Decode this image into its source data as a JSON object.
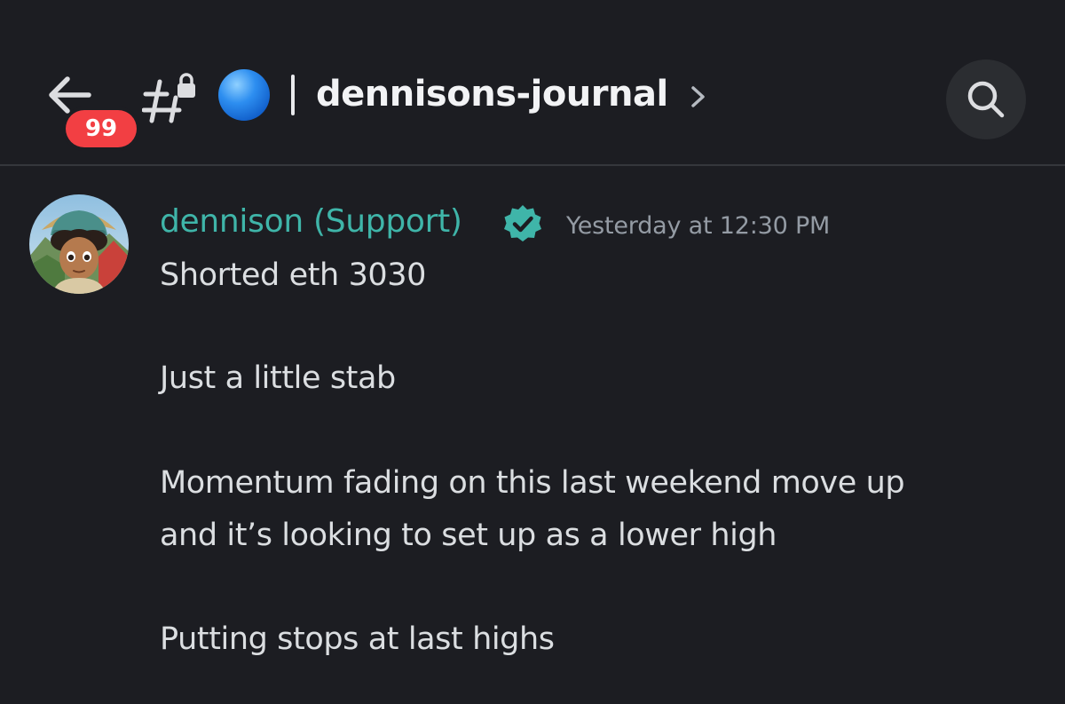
{
  "header": {
    "unread_count": "99",
    "channel_emoji": "blue-circle",
    "channel_name": "dennisons-journal",
    "icons": {
      "back": "arrow-left-icon",
      "channel": "locked-text-channel-icon",
      "chevron": "chevron-right-icon",
      "search": "search-icon"
    }
  },
  "message": {
    "author": "dennison (Support)",
    "author_color": "#3fb5a9",
    "verified": true,
    "timestamp": "Yesterday at 12:30 PM",
    "lines": [
      "Shorted eth 3030",
      "Just a little stab",
      "Momentum fading on this last weekend move up",
      "and it’s looking to set up as a lower high",
      "Putting stops at last highs"
    ]
  },
  "colors": {
    "background": "#1c1d22",
    "badge": "#f23f43",
    "accent_teal": "#3fb5a9",
    "muted_text": "#949ba4"
  }
}
